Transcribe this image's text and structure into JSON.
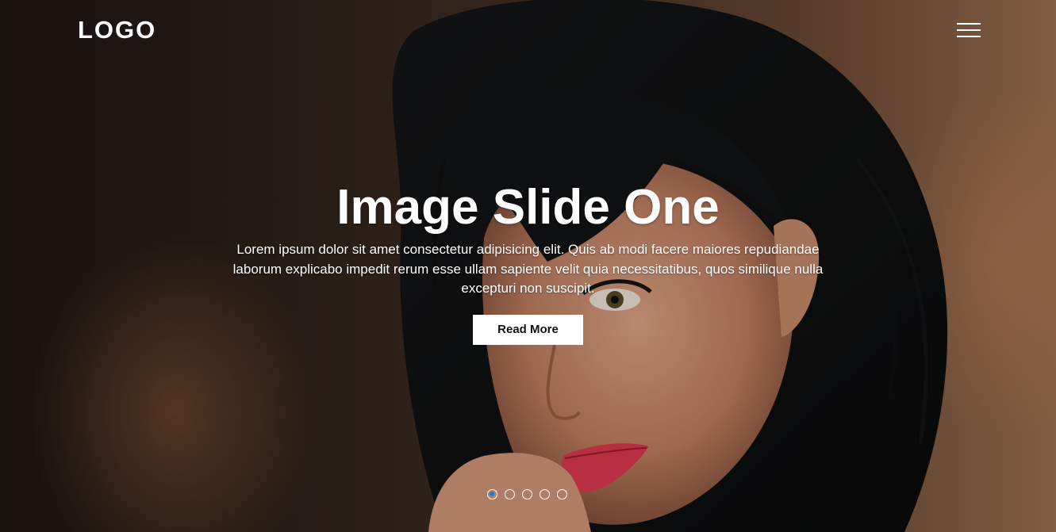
{
  "header": {
    "logo": "LOGO",
    "menu_icon": "hamburger-menu-icon"
  },
  "slide": {
    "title": "Image Slide One",
    "description": "Lorem ipsum dolor sit amet consectetur adipisicing elit. Quis ab modi facere maiores repudiandae laborum explicabo impedit rerum esse ullam sapiente velit quia necessitatibus, quos similique nulla excepturi non suscipit.",
    "button_label": "Read More"
  },
  "slider": {
    "total_slides": 5,
    "active_index": 0
  },
  "colors": {
    "text": "#ffffff",
    "button_background": "#ffffff",
    "button_text": "#111111",
    "active_dot": "#1e7bd8"
  }
}
